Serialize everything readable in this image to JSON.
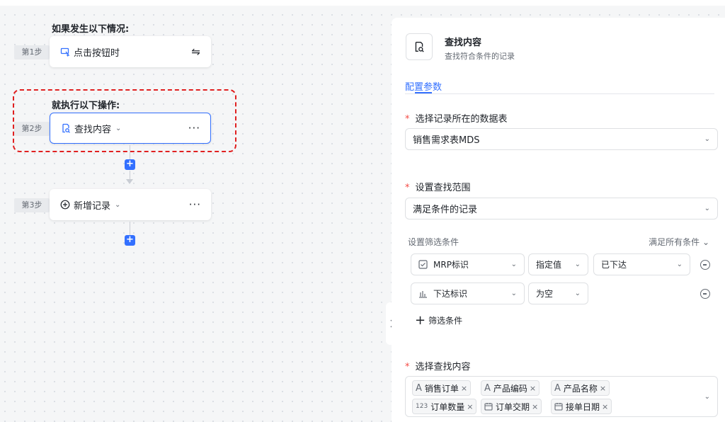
{
  "canvas": {
    "trigger_title": "如果发生以下情况:",
    "action_title": "就执行以下操作:",
    "steps": [
      {
        "tag": "第1步",
        "label": "点击按钮时",
        "icon": "cursor-click-icon",
        "right": "⇋"
      },
      {
        "tag": "第2步",
        "label": "查找内容",
        "icon": "find-record-icon",
        "right": "···"
      },
      {
        "tag": "第3步",
        "label": "新增记录",
        "icon": "add-circle-icon",
        "right": "···"
      }
    ],
    "add_step": "+"
  },
  "panel": {
    "title": "查找内容",
    "subtitle": "查找符合条件的记录",
    "tab": "配置参数",
    "table_label": "选择记录所在的数据表",
    "table_value": "销售需求表MDS",
    "scope_label": "设置查找范围",
    "scope_value": "满足条件的记录",
    "filter_head": "设置筛选条件",
    "filter_mode": "满足所有条件",
    "filters": [
      {
        "field": "MRP标识",
        "field_icon": "checkbox-field-icon",
        "op": "指定值",
        "value": "已下达"
      },
      {
        "field": "下达标识",
        "field_icon": "bar-chart-field-icon",
        "op": "为空",
        "value": ""
      }
    ],
    "add_filter": "筛选条件",
    "content_label": "选择查找内容",
    "content_tags": [
      {
        "icon": "text-field-icon",
        "glyph": "A",
        "label": "销售订单"
      },
      {
        "icon": "text-field-icon",
        "glyph": "A",
        "label": "产品编码"
      },
      {
        "icon": "text-field-icon",
        "glyph": "A",
        "label": "产品名称"
      },
      {
        "icon": "number-field-icon",
        "glyph": "123",
        "label": "订单数量"
      },
      {
        "icon": "date-field-icon",
        "glyph": "▭",
        "label": "订单交期"
      },
      {
        "icon": "date-field-icon",
        "glyph": "▭",
        "label": "接单日期"
      }
    ],
    "required_mark": "*",
    "remove_mark": "×"
  },
  "colors": {
    "accent": "#3370ff",
    "required": "#f54a45",
    "highlight": "#e02020"
  }
}
